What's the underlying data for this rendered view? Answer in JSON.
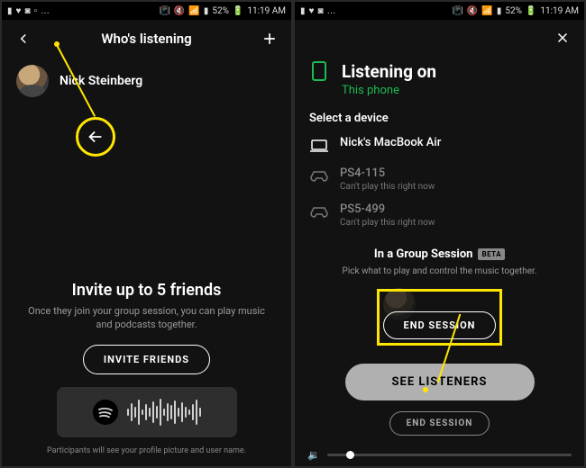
{
  "statusbar": {
    "network": "52%",
    "time": "11:19 AM"
  },
  "left": {
    "header_title": "Who's listening",
    "profile_name": "Nick Steinberg",
    "invite_title": "Invite up to 5 friends",
    "invite_sub": "Once they join your group session, you can play music and podcasts together.",
    "invite_button": "INVITE FRIENDS",
    "footnote": "Participants will see your profile picture and user name."
  },
  "right": {
    "listening_title": "Listening on",
    "listening_sub": "This phone",
    "select_label": "Select a device",
    "devices": [
      {
        "name": "Nick's MacBook Air",
        "sub": ""
      },
      {
        "name": "PS4-115",
        "sub": "Can't play this right now"
      },
      {
        "name": "PS5-499",
        "sub": "Can't play this right now"
      }
    ],
    "group_title": "In a Group Session",
    "beta": "BETA",
    "group_sub": "Pick what to play and control the music together.",
    "end_session": "END SESSION",
    "see_listeners": "SEE LISTENERS",
    "end_session_small": "END SESSION"
  }
}
